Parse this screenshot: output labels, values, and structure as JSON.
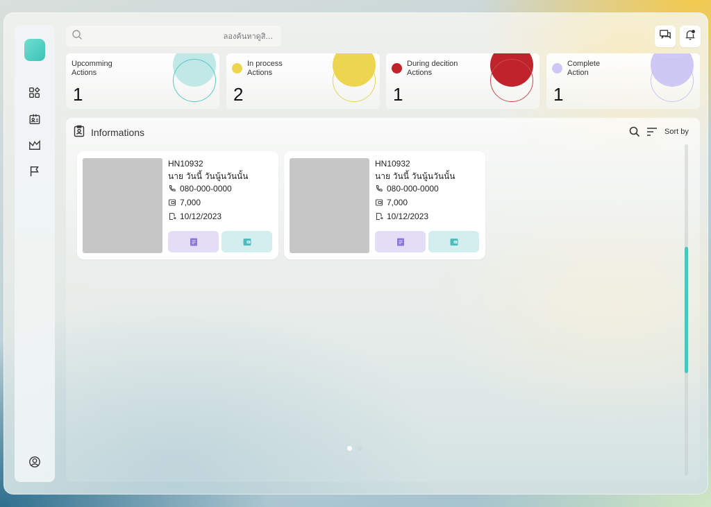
{
  "colors": {
    "accent": "#3cc2b8",
    "upcoming": "#bfe8e6",
    "upcoming_ring": "#59c6c6",
    "in_process": "#ecd64f",
    "in_process_ring": "#e6d35a",
    "during_decision": "#c0232b",
    "during_decision_ring": "#c84a4a",
    "complete": "#cdc8f4",
    "complete_ring": "#c8c4ef",
    "doc_button_bg": "#e3ddf6",
    "doc_button_icon": "#8a78d6",
    "wallet_button_bg": "#d3eeee",
    "wallet_button_icon": "#4fbcbc"
  },
  "sidebar": {
    "items": [
      {
        "icon": "dashboard-icon"
      },
      {
        "icon": "id-card-icon"
      },
      {
        "icon": "chart-icon"
      },
      {
        "icon": "flag-icon"
      }
    ],
    "footer_icon": "user-profile-icon"
  },
  "search": {
    "placeholder": "ลองค้นหาดูสิ..."
  },
  "topbar": {
    "icons": [
      "chat-icon",
      "notification-bell-icon"
    ]
  },
  "stats": [
    {
      "label": "Upcomming\nActions",
      "value": "1"
    },
    {
      "label": "In process\nActions",
      "value": "2"
    },
    {
      "label": "During decition\nActions",
      "value": "1"
    },
    {
      "label": "Complete\nAction",
      "value": "1"
    }
  ],
  "informations": {
    "title": "Informations",
    "sort_label": "Sort by",
    "cards": [
      {
        "hn": "HN10932",
        "name": "นาย วันนี้ วันนู้นวันนั้น",
        "phone": "080-000-0000",
        "amount": "7,000",
        "date": "10/12/2023"
      },
      {
        "hn": "HN10932",
        "name": "นาย วันนี้ วันนู้นวันนั้น",
        "phone": "080-000-0000",
        "amount": "7,000",
        "date": "10/12/2023"
      }
    ],
    "pagination": {
      "pages": 2,
      "current": 1
    }
  }
}
